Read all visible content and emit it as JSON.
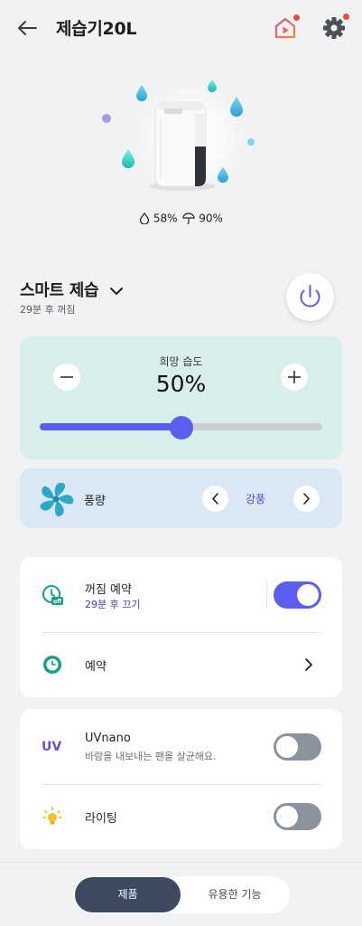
{
  "header": {
    "title": "제습기20L",
    "back_icon": "arrow-left-icon",
    "video_icon": "video-play-icon",
    "settings_icon": "gear-icon"
  },
  "status": {
    "current_humidity": "58%",
    "rain_probability": "90%"
  },
  "mode": {
    "name": "스마트 제습",
    "subtitle": "29분 후 꺼짐"
  },
  "humidity_control": {
    "label": "희망 습도",
    "value": "50%",
    "level_percent": 50
  },
  "fan": {
    "label": "풍량",
    "value": "강풍"
  },
  "timers": {
    "off_timer_title": "꺼짐 예약",
    "off_timer_sub": "29분 후 끄기",
    "off_timer_on": true,
    "schedule_title": "예약"
  },
  "extras": {
    "uv_badge": "UV",
    "uv_title": "UVnano",
    "uv_sub": "바람을 내보내는 팬을 살균해요.",
    "uv_on": false,
    "lighting_title": "라이팅",
    "lighting_on": false
  },
  "tabs": {
    "active": "제품",
    "inactive": "유용한 기능"
  },
  "colors": {
    "accent": "#5b5ef0",
    "teal": "#17a08a",
    "toggle_off": "#8a939e",
    "notification": "#f04a3a"
  }
}
